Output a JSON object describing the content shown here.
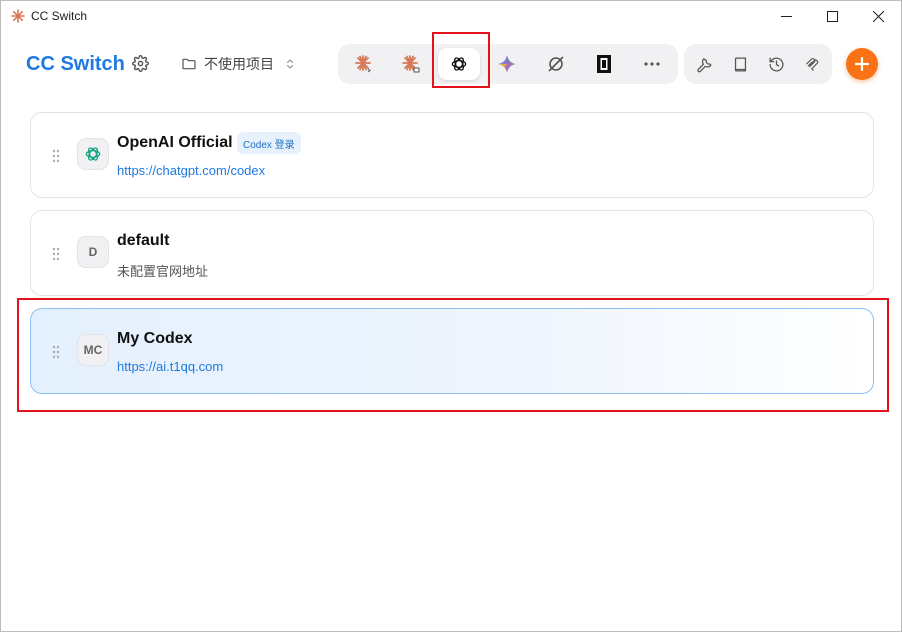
{
  "window": {
    "title": "CC Switch"
  },
  "header": {
    "brand": "CC Switch",
    "project": "不使用项目"
  },
  "app_tabs": [
    {
      "icon": "claude-code-icon",
      "active": false
    },
    {
      "icon": "claude-desktop-icon",
      "active": false
    },
    {
      "icon": "openai-icon",
      "active": true
    },
    {
      "icon": "gemini-icon",
      "active": false
    },
    {
      "icon": "opencode-icon",
      "active": false
    },
    {
      "icon": "terminal-app-icon",
      "active": false
    },
    {
      "icon": "more-icon",
      "active": false
    }
  ],
  "tool_tabs": [
    {
      "icon": "wrench-icon"
    },
    {
      "icon": "book-icon"
    },
    {
      "icon": "history-icon"
    },
    {
      "icon": "mcp-icon"
    }
  ],
  "providers": [
    {
      "name": "OpenAI Official",
      "url": "https://chatgpt.com/codex",
      "badge": "Codex 登录",
      "avatar": "openai-icon",
      "active": false
    },
    {
      "name": "default",
      "url": "未配置官网地址",
      "avatar_text": "D",
      "active": false
    },
    {
      "name": "My Codex",
      "url": "https://ai.t1qq.com",
      "avatar_text": "MC",
      "active": true
    }
  ],
  "colors": {
    "brand": "#1f7ae0",
    "accent_orange": "#f97316",
    "highlight_red": "#e3121b",
    "claude_orange": "#d97757"
  }
}
